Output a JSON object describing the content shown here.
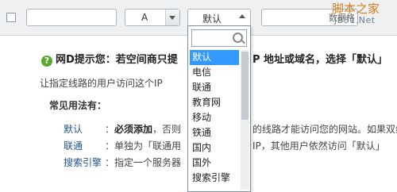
{
  "toolbar": {
    "select_a_value": "A",
    "select_line_value": "默认"
  },
  "dropdown": {
    "items": [
      "默认",
      "电信",
      "联通",
      "教育网",
      "移动",
      "铁通",
      "国内",
      "国外",
      "搜索引擎"
    ],
    "selected_index": 0,
    "search_placeholder": ""
  },
  "watermark": {
    "line1": "脚本之家",
    "line2": "JB51.Net",
    "overlap_fragment": "数据格"
  },
  "tip": {
    "text": "网D提示您：若空间商只提",
    "text_tail": "P 地址或域名，选择「默认」"
  },
  "description": "让指定线路的用户访问这个IP",
  "usage": {
    "title": "常见用法有：",
    "rows": [
      {
        "key": "默认",
        "sep": "：",
        "bold": "必须添加",
        "text": "，否则",
        "tail": "的线路才能访问您的网站。如果双线"
      },
      {
        "key": "联通",
        "sep": "：",
        "bold": "",
        "text": "单独为「联通用",
        "tail": "IP，其他用户依然访问「默认」"
      },
      {
        "key": "搜索引擎",
        "sep": "：",
        "bold": "",
        "text": "指定一个服务器",
        "tail": ""
      }
    ]
  }
}
